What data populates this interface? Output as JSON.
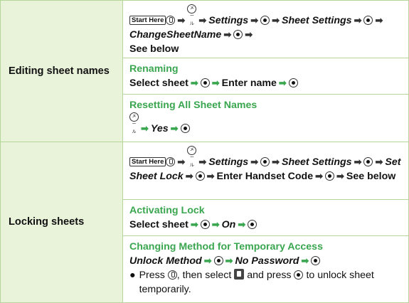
{
  "rows": [
    {
      "label": "Editing sheet names",
      "path": {
        "start": "Start Here",
        "settings": "Settings",
        "sheet_settings": "Sheet Settings",
        "item": "ChangeSheetName",
        "tail": "See below"
      },
      "subs": [
        {
          "title": "Renaming",
          "select": "Select sheet",
          "enter": "Enter name"
        },
        {
          "title": "Resetting All Sheet Names",
          "yes": "Yes"
        }
      ]
    },
    {
      "label": "Locking sheets",
      "path": {
        "start": "Start Here",
        "settings": "Settings",
        "sheet_settings": "Sheet Settings",
        "item": "Set Sheet Lock",
        "enter": "Enter Handset Code",
        "tail": "See below"
      },
      "subs": [
        {
          "title": "Activating Lock",
          "select": "Select sheet",
          "on": "On"
        },
        {
          "title": "Changing Method for Temporary Access",
          "unlock": "Unlock Method",
          "no_password": "No Password",
          "note_a": "Press",
          "note_b": ", then select",
          "note_c": "and press",
          "note_d": "to unlock sheet temporarily."
        }
      ]
    }
  ],
  "key_soft_label": "メール",
  "bullet": "●"
}
